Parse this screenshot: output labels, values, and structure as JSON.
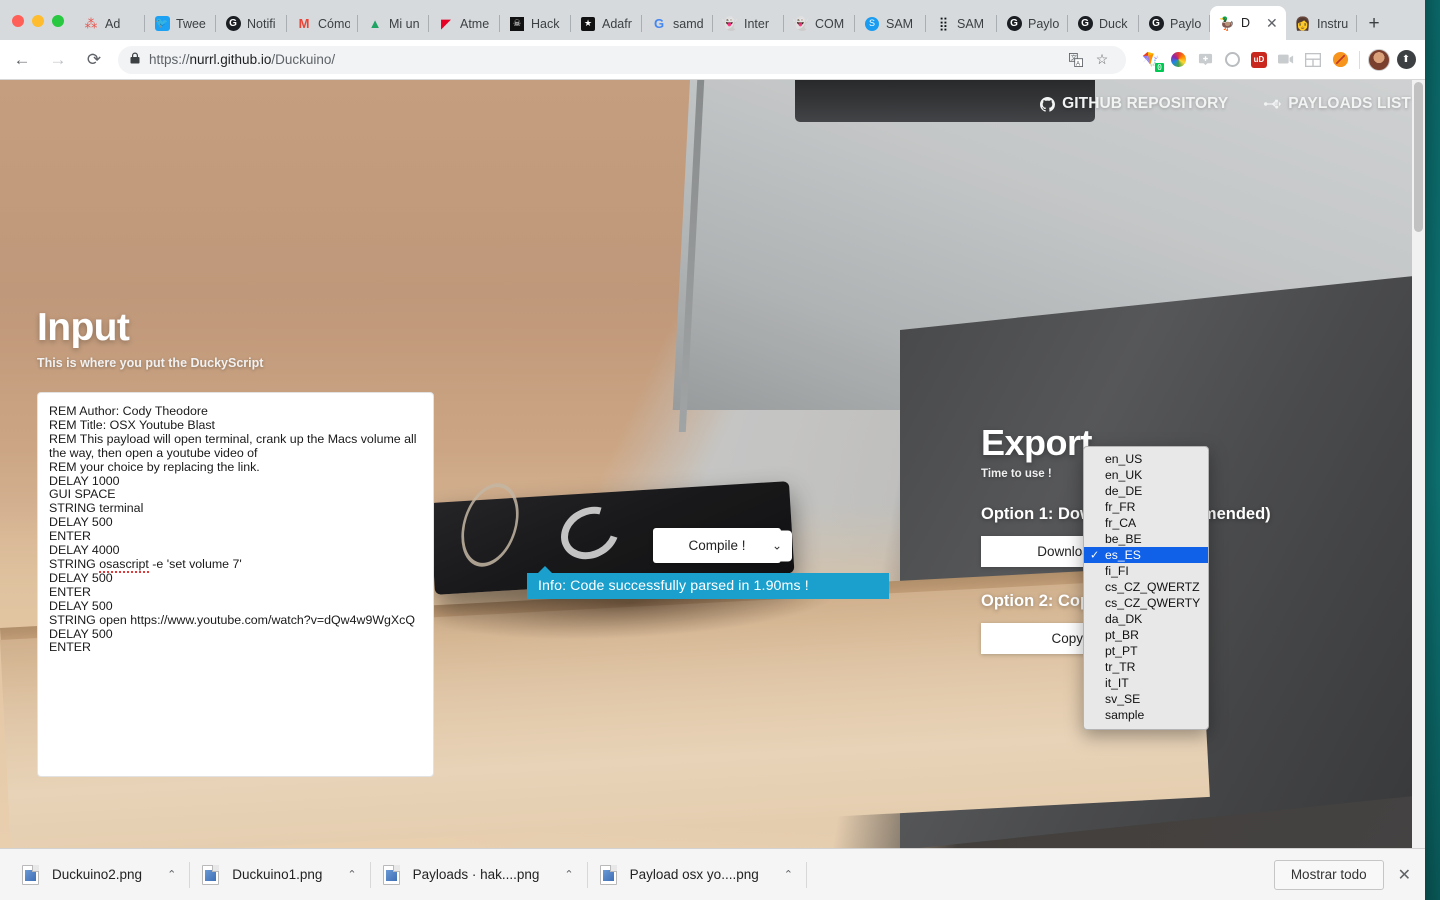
{
  "browser": {
    "window_controls": [
      "close",
      "minimize",
      "maximize"
    ],
    "tabs": [
      {
        "label": "Ad",
        "icon": "dots-icon"
      },
      {
        "label": "Twee",
        "icon": "twitter-icon"
      },
      {
        "label": "Notifi",
        "icon": "github-icon"
      },
      {
        "label": "Cómo",
        "icon": "gmail-icon"
      },
      {
        "label": "Mi un",
        "icon": "google-drive-icon"
      },
      {
        "label": "Atme",
        "icon": "pinterest-icon"
      },
      {
        "label": "Hack",
        "icon": "skull-icon"
      },
      {
        "label": "Adafr",
        "icon": "adafruit-star-icon"
      },
      {
        "label": "samd",
        "icon": "google-icon"
      },
      {
        "label": "Inter",
        "icon": "ghost-icon"
      },
      {
        "label": "COM",
        "icon": "ghost-icon"
      },
      {
        "label": "SAM",
        "icon": "samy-blue-icon"
      },
      {
        "label": "SAM",
        "icon": "dot-grid-icon"
      },
      {
        "label": "Paylo",
        "icon": "github-icon"
      },
      {
        "label": "Duck",
        "icon": "github-icon"
      },
      {
        "label": "Paylo",
        "icon": "github-icon"
      }
    ],
    "active_tab": {
      "label": "D",
      "icon": "duck-icon",
      "close_glyph": "✕"
    },
    "tab_after_active": {
      "label": "Instru",
      "icon": "person-icon"
    },
    "new_tab_glyph": "+",
    "nav": {
      "back_glyph": "←",
      "forward_glyph": "→",
      "reload_glyph": "⟳"
    },
    "omnibox": {
      "lock_glyph": "🔒",
      "url_scheme": "https://",
      "url_host": "nurrl.github.io",
      "url_path": "/Duckuino/",
      "translate_icon": "translate-icon",
      "bookmark_glyph": "☆"
    },
    "extensions": [
      {
        "name": "wappalyzer-icon",
        "badge": "0"
      },
      {
        "name": "color-wheel-icon",
        "badge": ""
      },
      {
        "name": "add-to-icon",
        "badge": ""
      },
      {
        "name": "grammarly-icon",
        "badge": ""
      },
      {
        "name": "ublock-origin-icon",
        "badge": ""
      },
      {
        "name": "video-recorder-icon",
        "badge": ""
      },
      {
        "name": "split-screen-icon",
        "badge": ""
      },
      {
        "name": "orange-slash-icon",
        "badge": ""
      }
    ],
    "profile": {
      "name": "avatar"
    },
    "update_icon": "update-arrow-icon"
  },
  "site": {
    "header": {
      "github_link": "GITHUB REPOSITORY",
      "payloads_link": "PAYLOADS LIST"
    },
    "input": {
      "title": "Input",
      "subtitle": "This is where you put the DuckyScript",
      "script_lines": [
        "REM Author: Cody Theodore",
        "REM Title: OSX Youtube Blast",
        "REM This payload will open terminal, crank up the Macs volume all the way, then open a youtube video of",
        "REM your choice by replacing the link.",
        "DELAY 1000",
        "GUI SPACE",
        "STRING terminal",
        "DELAY 500",
        "ENTER",
        "DELAY 4000",
        "STRING osascript -e 'set volume 7'",
        "DELAY 500",
        "ENTER",
        "DELAY 500",
        "STRING open https://www.youtube.com/watch?v=dQw4w9WgXcQ",
        "DELAY 500",
        "ENTER"
      ],
      "misspelled_word": "osascript"
    },
    "compile": {
      "button_label": "Compile !",
      "caret_glyph": "⌄",
      "info_message": "Info: Code successfully parsed in 1.90ms !",
      "info_bg": "#1ba0cd"
    },
    "export": {
      "title": "Export",
      "subtitle": "Time to use !",
      "option1_heading": "Option 1: Download (Recommended)",
      "download_label": "Download !",
      "option2_heading": "Option 2: Copy / Paste",
      "copy_label": "Copy !"
    },
    "language_dropdown": {
      "selected": "es_ES",
      "options": [
        "en_US",
        "en_UK",
        "de_DE",
        "fr_FR",
        "fr_CA",
        "be_BE",
        "es_ES",
        "fi_FI",
        "cs_CZ_QWERTZ",
        "cs_CZ_QWERTY",
        "da_DK",
        "pt_BR",
        "pt_PT",
        "tr_TR",
        "it_IT",
        "sv_SE",
        "sample"
      ],
      "highlight_color": "#1060e8"
    }
  },
  "downloads": {
    "items": [
      {
        "name": "Duckuino2.png",
        "caret": "⌃"
      },
      {
        "name": "Duckuino1.png",
        "caret": "⌃"
      },
      {
        "name": "Payloads · hak....png",
        "caret": "⌃"
      },
      {
        "name": "Payload osx yo....png",
        "caret": "⌃"
      }
    ],
    "show_all_label": "Mostrar todo",
    "close_glyph": "✕"
  }
}
